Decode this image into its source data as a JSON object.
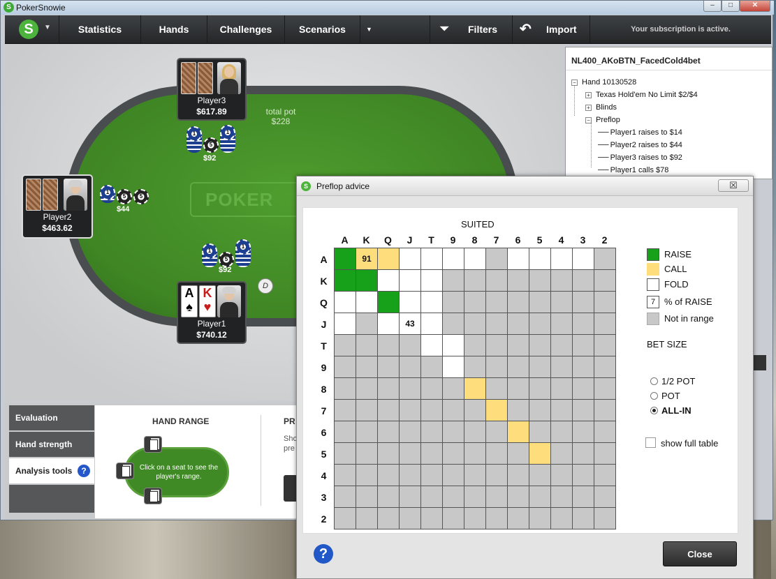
{
  "window": {
    "title": "PokerSnowie"
  },
  "nav": {
    "items": [
      "Statistics",
      "Hands",
      "Challenges",
      "Scenarios"
    ],
    "filters": "Filters",
    "import": "Import",
    "subscription": "Your subscription is active."
  },
  "table": {
    "watermark": "POKER",
    "total_pot_label": "total pot",
    "total_pot": "$228",
    "seats": [
      {
        "name": "Player3",
        "stack": "$617.89"
      },
      {
        "name": "Player2",
        "stack": "$463.62"
      },
      {
        "name": "Player1",
        "stack": "$740.12"
      }
    ],
    "bets": {
      "player3": "$92",
      "player2": "$44",
      "player1": "$92"
    },
    "chip_labels": {
      "one": "1",
      "five": "5"
    },
    "hero_cards": [
      {
        "rank": "A",
        "suit": "♠"
      },
      {
        "rank": "K",
        "suit": "♥"
      }
    ],
    "dealer": "D"
  },
  "hand_tree": {
    "title": "NL400_AKoBTN_FacedCold4bet",
    "root": "Hand 10130528",
    "nodes": [
      "Texas Hold'em No Limit $2/$4",
      "Blinds",
      "Preflop"
    ],
    "actions": [
      "Player1 raises to $14",
      "Player2 raises to $44",
      "Player3 raises to $92",
      "Player1 calls $78"
    ]
  },
  "bottom": {
    "tabs": [
      "Evaluation",
      "Hand strength",
      "Analysis tools"
    ],
    "hand_range_title": "HAND RANGE",
    "hand_range_hint": "Click on a seat to see the player's range.",
    "cut_title": "PR",
    "cut_text_1": "Sho",
    "cut_text_2": "pre"
  },
  "dialog": {
    "title": "Preflop advice",
    "close_x": "☒",
    "suited_label": "SUITED",
    "ranks": [
      "A",
      "K",
      "Q",
      "J",
      "T",
      "9",
      "8",
      "7",
      "6",
      "5",
      "4",
      "3",
      "2"
    ],
    "grid_colors": {
      "R": "#17a11a",
      "C": "#fedd7c",
      "F": "#ffffff",
      "N": "#c8c8c8"
    },
    "grid": [
      "RCCFFFFNFFFFN",
      "RRFFFNNNNNNNN",
      "FFRFFNNNNNNNN",
      "FNFFFNNNNNNNN",
      "NNNNFFNNNNNNN",
      "NNNNNFNNNNNNN",
      "NNNNNNCNNNNNN",
      "NNNNNNNCNNNNN",
      "NNNNNNNNCNNNN",
      "NNNNNNNNNCNNN",
      "NNNNNNNNNNNNN",
      "NNNNNNNNNNNNN",
      "NNNNNNNNNNNNN"
    ],
    "cell_labels": {
      "0-1": "91",
      "3-3": "43"
    },
    "legend": {
      "raise": "RAISE",
      "call": "CALL",
      "fold": "FOLD",
      "pct_box": "7",
      "pct": "% of RAISE",
      "not_in_range": "Not in range"
    },
    "bet_size_label": "BET SIZE",
    "bet_sizes": [
      "1/2 POT",
      "POT",
      "ALL-IN"
    ],
    "selected_bet": "ALL-IN",
    "show_full_table": "show full table",
    "close_button": "Close"
  }
}
